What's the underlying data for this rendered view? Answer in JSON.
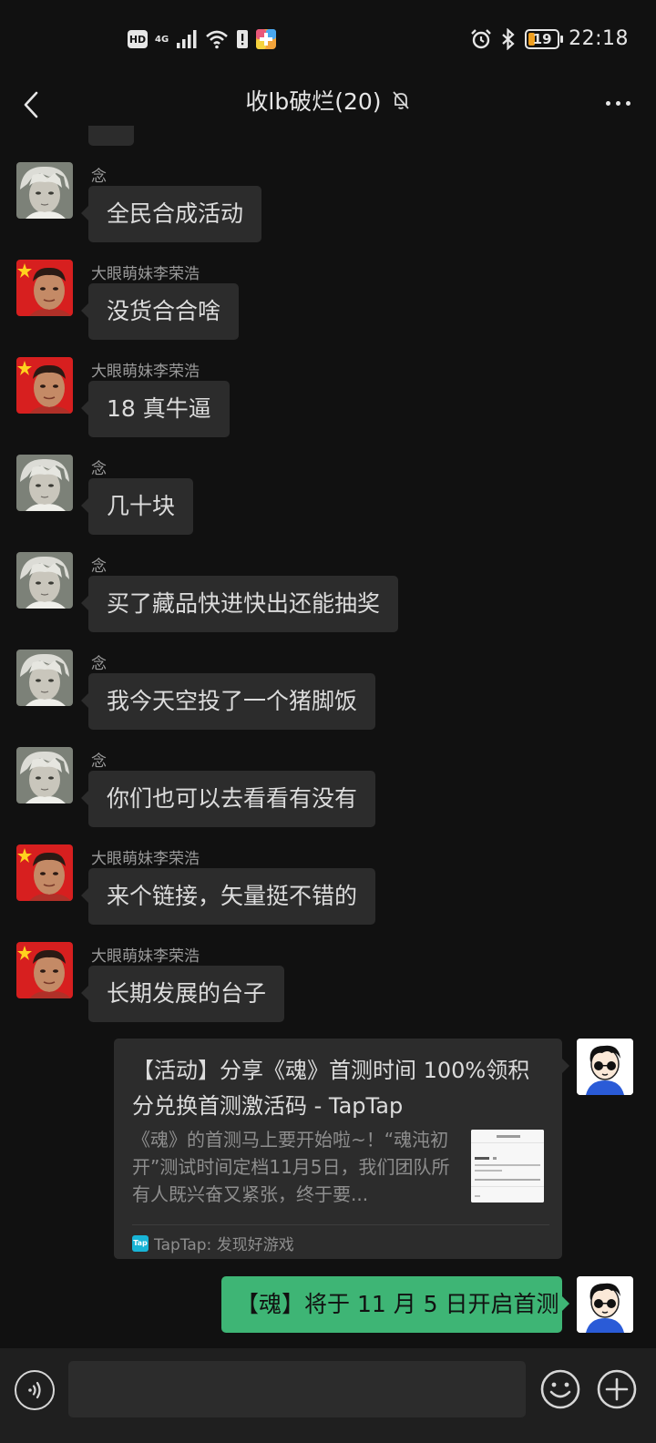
{
  "status_bar": {
    "hd": "HD",
    "network": "4G",
    "battery_level": "19",
    "battery_fraction": 0.19,
    "time": "22:18",
    "icons": [
      "hd-icon",
      "signal-icon",
      "wifi-icon",
      "alert-icon",
      "app-icon",
      "alarm-icon",
      "bluetooth-icon",
      "battery-icon"
    ]
  },
  "header": {
    "title": "收lb破烂(20)",
    "muted_icon": "bell-off-icon",
    "back_icon": "back-arrow-icon",
    "more_icon": "more-icon"
  },
  "messages": [
    {
      "sender": "念",
      "avatar": "anime-avatar",
      "text": "全民合成活动"
    },
    {
      "sender": "大眼萌妹李荣浩",
      "avatar": "flag-avatar",
      "text": "没货合合啥"
    },
    {
      "sender": "大眼萌妹李荣浩",
      "avatar": "flag-avatar",
      "text": "18 真牛逼"
    },
    {
      "sender": "念",
      "avatar": "anime-avatar",
      "text": "几十块"
    },
    {
      "sender": "念",
      "avatar": "anime-avatar",
      "text": "买了藏品快进快出还能抽奖"
    },
    {
      "sender": "念",
      "avatar": "anime-avatar",
      "text": "我今天空投了一个猪脚饭"
    },
    {
      "sender": "念",
      "avatar": "anime-avatar",
      "text": "你们也可以去看看有没有"
    },
    {
      "sender": "大眼萌妹李荣浩",
      "avatar": "flag-avatar",
      "text": "来个链接，矢量挺不错的"
    },
    {
      "sender": "大眼萌妹李荣浩",
      "avatar": "flag-avatar",
      "text": "长期发展的台子"
    }
  ],
  "link_card": {
    "title": "【活动】分享《魂》首测时间 100%领积分兑换首测激活码 - TapTap",
    "description": "《魂》的首测马上要开始啦~！“魂沌初开”测试时间定档11月5日，我们团队所有人既兴奋又紧张，终于要...",
    "source_logo": "Tap",
    "source": "TapTap: 发现好游戏"
  },
  "my_message": {
    "text": "【魂】将于 11 月 5 日开启首测"
  },
  "input_bar": {
    "voice_icon": "voice-icon",
    "emoji_icon": "emoji-icon",
    "plus_icon": "plus-icon"
  },
  "colors": {
    "background": "#111111",
    "bubble": "#2c2c2c",
    "my_bubble": "#3eb575",
    "sender_text": "#9a9a9a"
  }
}
